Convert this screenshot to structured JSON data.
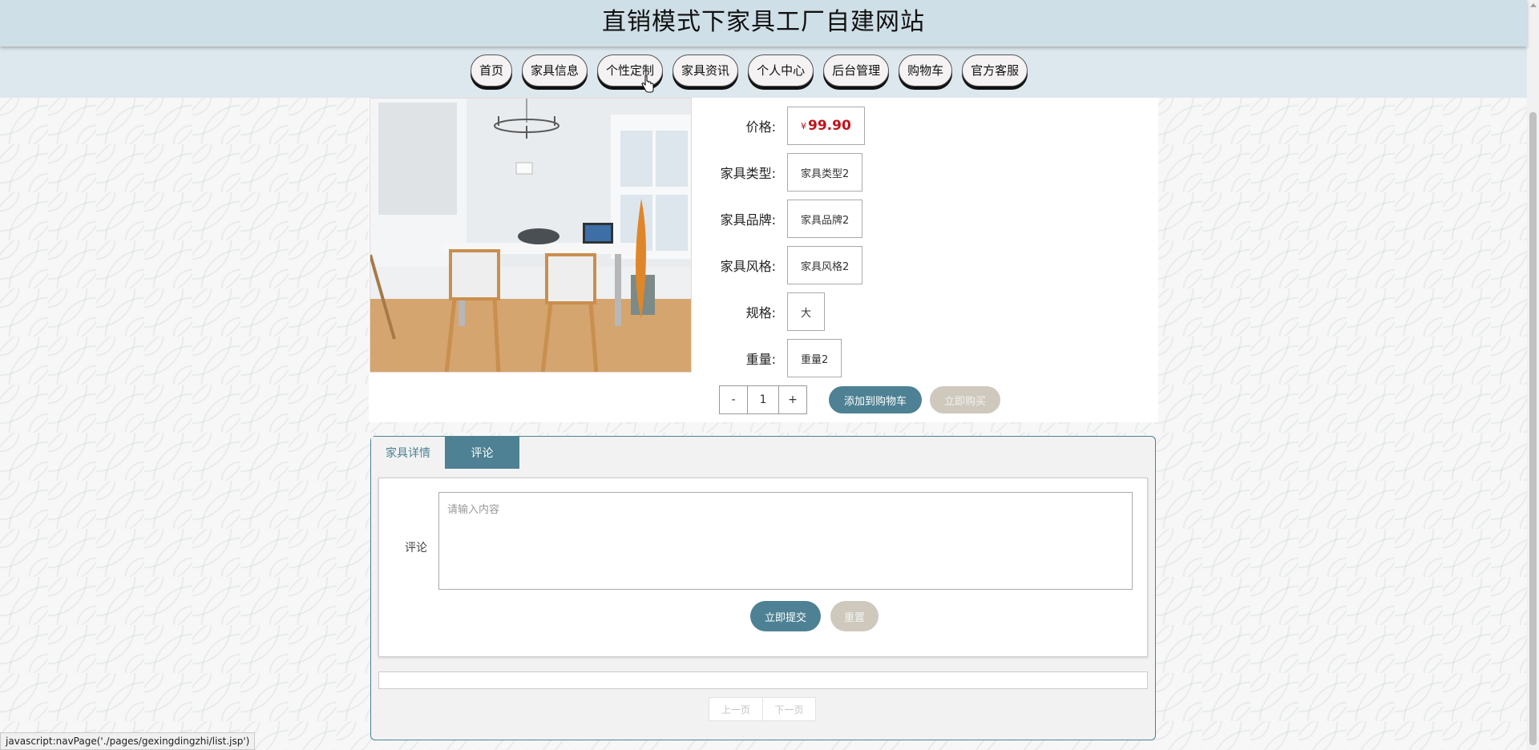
{
  "header": {
    "title": "直销模式下家具工厂自建网站"
  },
  "nav": {
    "items": [
      {
        "label": "首页"
      },
      {
        "label": "家具信息"
      },
      {
        "label": "个性定制"
      },
      {
        "label": "家具资讯"
      },
      {
        "label": "个人中心"
      },
      {
        "label": "后台管理"
      },
      {
        "label": "购物车"
      },
      {
        "label": "官方客服"
      }
    ]
  },
  "product": {
    "fields": [
      {
        "label": "价格:",
        "value": "99.90",
        "currency": "¥"
      },
      {
        "label": "家具类型:",
        "value": "家具类型2"
      },
      {
        "label": "家具品牌:",
        "value": "家具品牌2"
      },
      {
        "label": "家具风格:",
        "value": "家具风格2"
      },
      {
        "label": "规格:",
        "value": "大"
      },
      {
        "label": "重量:",
        "value": "重量2"
      }
    ],
    "quantity": {
      "minus": "-",
      "value": "1",
      "plus": "+"
    },
    "add_to_cart": "添加到购物车",
    "buy_now": "立即购买"
  },
  "tabs": [
    {
      "label": "家具详情"
    },
    {
      "label": "评论"
    }
  ],
  "comment": {
    "label": "评论",
    "placeholder": "请输入内容",
    "submit": "立即提交",
    "reset": "重置"
  },
  "pager": {
    "prev": "上一页",
    "next": "下一页"
  },
  "status_bar": {
    "text": "javascript:navPage('./pages/gexingdingzhi/list.jsp')"
  },
  "colors": {
    "accent": "#4d8193",
    "price": "#c0121c",
    "header_bg": "#cfdfe7"
  }
}
